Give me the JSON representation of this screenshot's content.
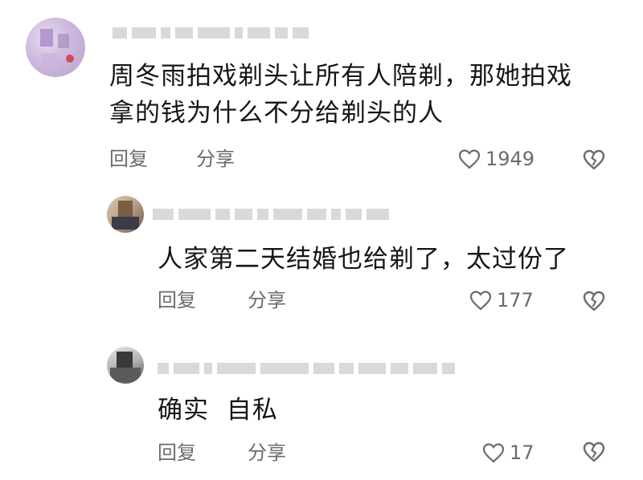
{
  "comments": [
    {
      "text": "周冬雨拍戏剃头让所有人陪剃，那她拍戏拿的钱为什么不分给剃头的人",
      "text_line1": "周冬雨拍戏剃头让所有人陪剃，那她拍戏",
      "text_line2": "拿的钱为什么不分给剃头的人",
      "reply_label": "回复",
      "share_label": "分享",
      "likes": "1949"
    },
    {
      "text": "人家第二天结婚也给剃了，太过份了",
      "reply_label": "回复",
      "share_label": "分享",
      "likes": "177"
    },
    {
      "text": "确实  自私",
      "reply_label": "回复",
      "share_label": "分享",
      "likes": "17"
    }
  ],
  "icons": {
    "like": "heart-outline-icon",
    "dislike": "broken-heart-icon"
  },
  "colors": {
    "text": "#161616",
    "muted": "#6b6b6b"
  }
}
